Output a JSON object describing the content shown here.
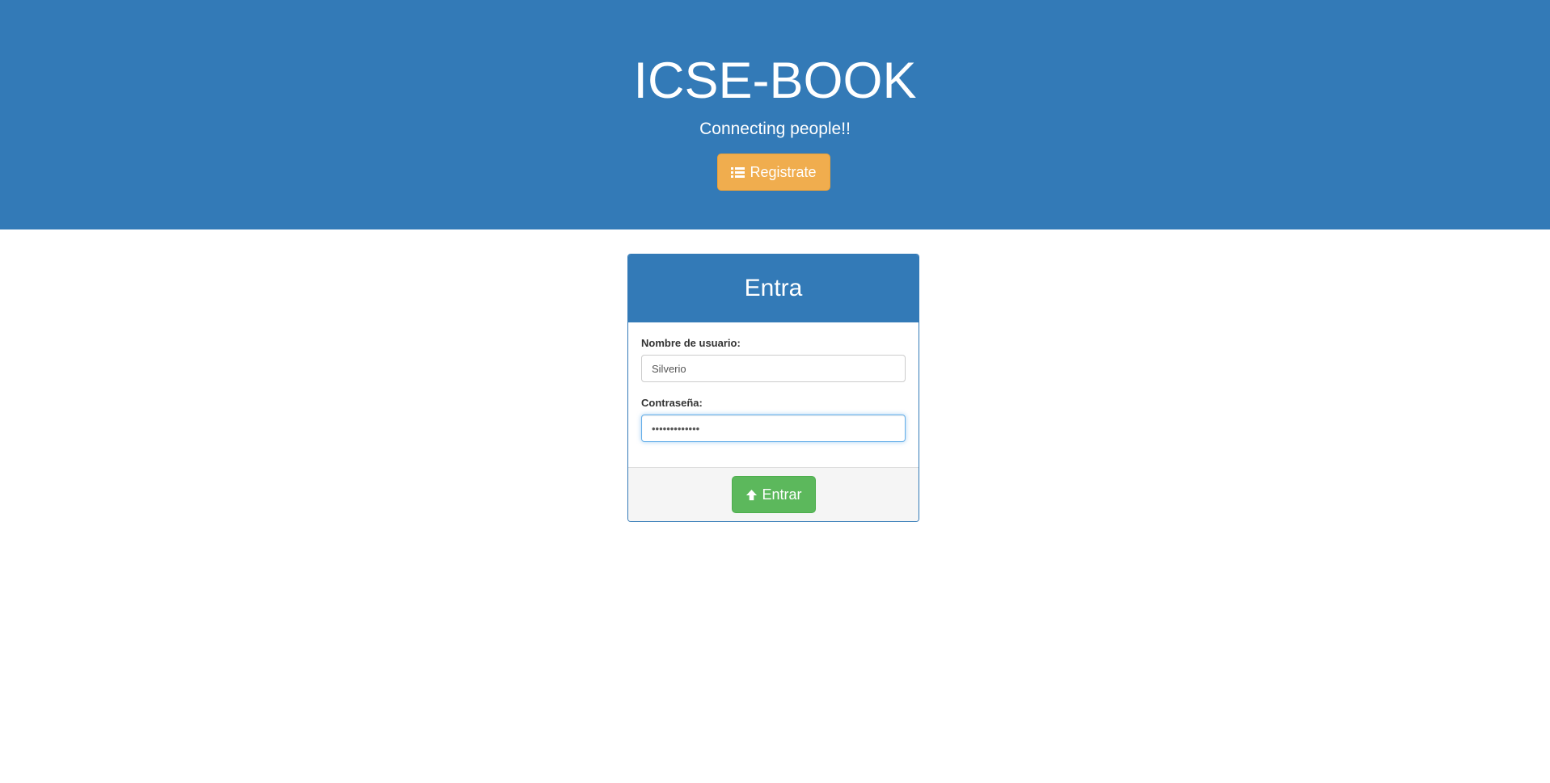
{
  "header": {
    "title": "ICSE-BOOK",
    "subtitle": "Connecting people!!",
    "register_button": {
      "label": "Registrate",
      "icon": "list-icon"
    }
  },
  "login_panel": {
    "heading": "Entra",
    "username": {
      "label": "Nombre de usuario:",
      "value": "Silverio"
    },
    "password": {
      "label": "Contraseña:",
      "value": "•••••••••••••"
    },
    "submit_button": {
      "label": "Entrar",
      "icon": "arrow-up-icon"
    }
  },
  "colors": {
    "primary": "#337ab7",
    "warning": "#f0ad4e",
    "success": "#5cb85c",
    "footer_bg": "#f5f5f5"
  }
}
